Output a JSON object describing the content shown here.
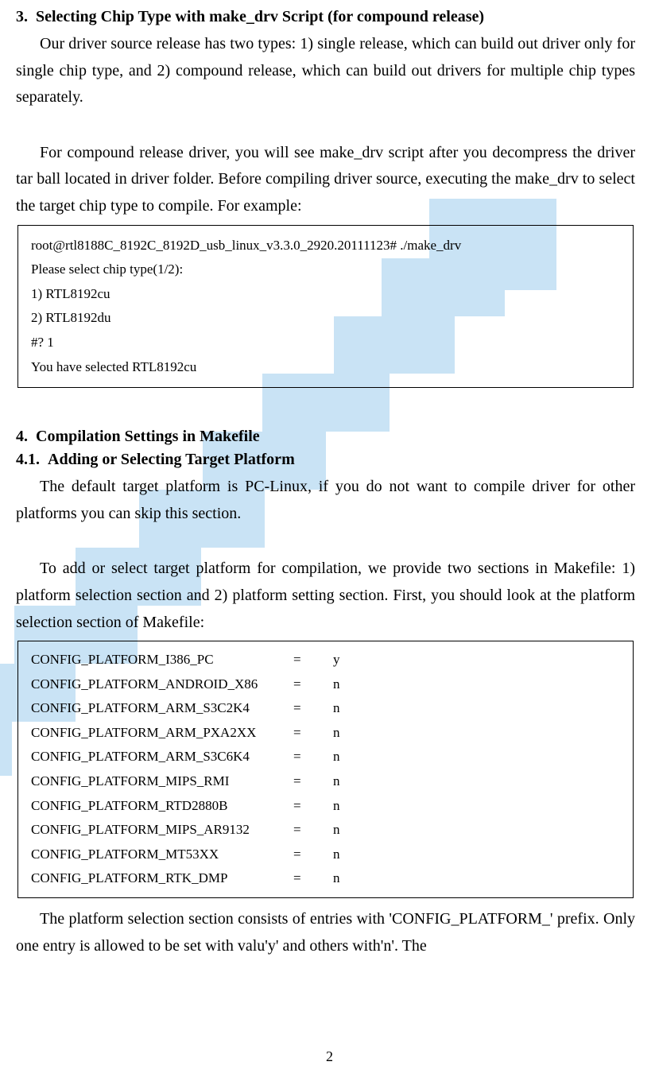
{
  "section3": {
    "number": "3.",
    "title": "Selecting Chip Type with make_drv Script (for compound release)",
    "para1": "Our driver source release has two types: 1) single release, which can build out driver only for single chip type, and 2) compound release, which can build out drivers for multiple chip types separately.",
    "para2": "For compound release driver, you will see make_drv script after you decompress the driver tar ball located in driver folder. Before compiling driver source, executing the make_drv to select the target chip type to compile. For example:"
  },
  "terminal": {
    "line1": "root@rtl8188C_8192C_8192D_usb_linux_v3.3.0_2920.20111123# ./make_drv",
    "line2": "Please select chip type(1/2):",
    "line3": "1) RTL8192cu",
    "line4": "2) RTL8192du",
    "line5": "#? 1",
    "line6": "You have selected RTL8192cu"
  },
  "section4": {
    "number": "4.",
    "title": "Compilation Settings in Makefile"
  },
  "section41": {
    "number": "4.1.",
    "title": "Adding or Selecting Target Platform",
    "para1": "The default target platform is PC-Linux, if you do not want to compile driver for other platforms you can skip this section.",
    "para2": "To add or select target platform for compilation, we provide two sections in Makefile: 1) platform selection section and 2) platform setting section. First, you should look at the platform selection section of Makefile:"
  },
  "config": {
    "rows": [
      {
        "name": "CONFIG_PLATFORM_I386_PC",
        "eq": "=",
        "val": "y"
      },
      {
        "name": "CONFIG_PLATFORM_ANDROID_X86",
        "eq": "=",
        "val": "n"
      },
      {
        "name": "CONFIG_PLATFORM_ARM_S3C2K4",
        "eq": "=",
        "val": "n"
      },
      {
        "name": "CONFIG_PLATFORM_ARM_PXA2XX",
        "eq": "=",
        "val": "n"
      },
      {
        "name": "CONFIG_PLATFORM_ARM_S3C6K4",
        "eq": "=",
        "val": "n"
      },
      {
        "name": "CONFIG_PLATFORM_MIPS_RMI",
        "eq": "=",
        "val": "n"
      },
      {
        "name": "CONFIG_PLATFORM_RTD2880B",
        "eq": "=",
        "val": "n"
      },
      {
        "name": "CONFIG_PLATFORM_MIPS_AR9132",
        "eq": "=",
        "val": "n"
      },
      {
        "name": "CONFIG_PLATFORM_MT53XX",
        "eq": "=",
        "val": "n"
      },
      {
        "name": "CONFIG_PLATFORM_RTK_DMP",
        "eq": "=",
        "val": "n"
      }
    ]
  },
  "closing": {
    "para": "The platform selection section consists of entries with 'CONFIG_PLATFORM_' prefix. Only one entry is allowed to be set with valu'y' and others with'n'. The"
  },
  "page_number": "2"
}
